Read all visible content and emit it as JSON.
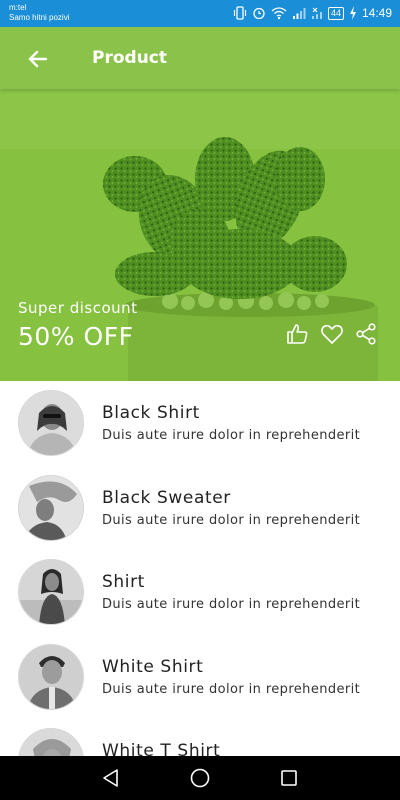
{
  "status_bar": {
    "carrier": "m:tel",
    "carrier_note": "Samo hitni pozivi",
    "battery": "44",
    "time": "14:49"
  },
  "app_bar": {
    "title": "Product",
    "back_icon": "arrow-back-icon"
  },
  "hero": {
    "subtitle": "Super discount",
    "headline": "50% OFF",
    "actions": [
      "thumb-up-icon",
      "heart-icon",
      "share-icon"
    ],
    "background_color": "#86c140"
  },
  "products": [
    {
      "title": "Black Shirt",
      "description": "Duis aute irure dolor in reprehenderit"
    },
    {
      "title": "Black Sweater",
      "description": "Duis aute irure dolor in reprehenderit"
    },
    {
      "title": "Shirt",
      "description": "Duis aute irure dolor in reprehenderit"
    },
    {
      "title": "White Shirt",
      "description": "Duis aute irure dolor in reprehenderit"
    },
    {
      "title": "White T Shirt",
      "description": ""
    }
  ],
  "colors": {
    "status_bar": "#1a8ed6",
    "app_bar": "#8bc34a",
    "nav_bar": "#000000"
  },
  "nav_bar": {
    "buttons": [
      "back-triangle-icon",
      "home-circle-icon",
      "recents-square-icon"
    ]
  }
}
